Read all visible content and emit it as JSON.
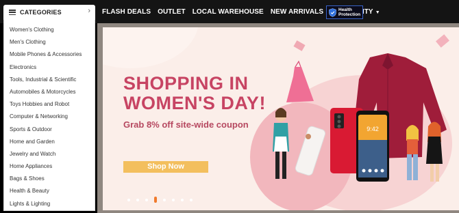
{
  "categories_header": {
    "label": "CATEGORIES"
  },
  "nav": {
    "items": [
      "FLASH DEALS",
      "OUTLET",
      "LOCAL WAREHOUSE",
      "NEW ARRIVALS",
      "COMMUNITY"
    ],
    "community_caret": "▼"
  },
  "health_badge": {
    "line1": "Health",
    "line2": "Protection"
  },
  "sidebar": {
    "items": [
      "Women's Clothing",
      "Men's Clothing",
      "Mobile Phones & Accessories",
      "Electronics",
      "Tools, Industrial & Scientific",
      "Automobiles & Motorcycles",
      "Toys Hobbies and Robot",
      "Computer & Networking",
      "Sports & Outdoor",
      "Home and Garden",
      "Jewelry and Watch",
      "Home Appliances",
      "Bags & Shoes",
      "Health & Beauty",
      "Lights & Lighting"
    ]
  },
  "banner": {
    "headline_line1": "SHOPPING IN",
    "headline_line2": "WOMEN'S DAY!",
    "subline": "Grab 8% off site-wide coupon",
    "cta": "Shop Now",
    "phone_time": "9:42",
    "carousel": {
      "count": 8,
      "active": 3
    }
  },
  "colors": {
    "headline": "#c74463",
    "cta_bg": "#f3bf5e",
    "active_dot": "#f07a2c",
    "topbar_bg": "#141414"
  }
}
